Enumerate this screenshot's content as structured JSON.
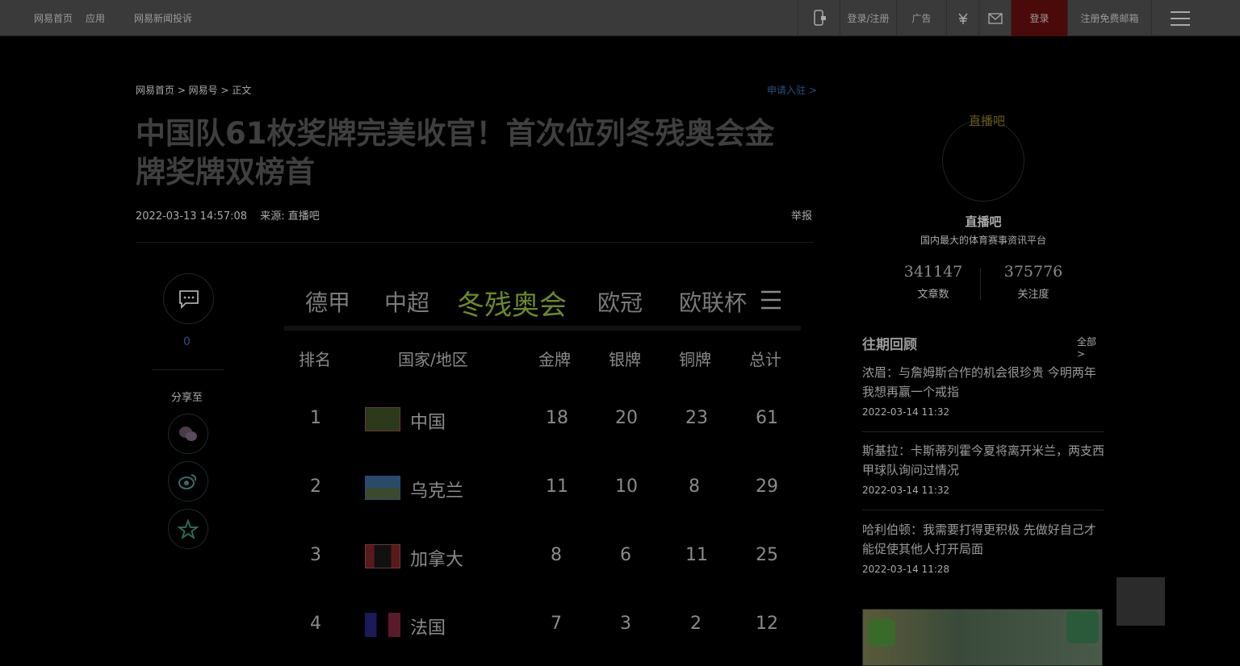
{
  "topbar": {
    "home": "网易首页",
    "app": "应用",
    "ad_link": "网易新闻投诉",
    "mobile": "",
    "account": "登录/注册",
    "games": "广告",
    "login": "登录",
    "user": "注册免费邮箱"
  },
  "breadcrumb": "网易首页 > 网易号 > 正文",
  "apply": "申请入驻 >",
  "article": {
    "title": "中国队61枚奖牌完美收官！首次位列冬残奥会金牌奖牌双榜首",
    "datetime": "2022-03-13 14:57:08",
    "source": "来源: 直播吧",
    "report": "举报"
  },
  "share": {
    "comment_count": "0",
    "label": "分享至"
  },
  "medal_table": {
    "tabs": [
      "德甲",
      "中超",
      "冬残奥会",
      "欧冠",
      "欧联杯"
    ],
    "active_tab": "冬残奥会",
    "headers": [
      "排名",
      "国家/地区",
      "金牌",
      "银牌",
      "铜牌",
      "总计"
    ],
    "rows": [
      {
        "rank": "1",
        "country": "中国",
        "gold": "18",
        "silver": "20",
        "bronze": "23",
        "total": "61"
      },
      {
        "rank": "2",
        "country": "乌克兰",
        "gold": "11",
        "silver": "10",
        "bronze": "8",
        "total": "29"
      },
      {
        "rank": "3",
        "country": "加拿大",
        "gold": "8",
        "silver": "6",
        "bronze": "11",
        "total": "25"
      },
      {
        "rank": "4",
        "country": "法国",
        "gold": "7",
        "silver": "3",
        "bronze": "2",
        "total": "12"
      }
    ]
  },
  "author": {
    "avatar_alt": "直播吧",
    "name": "直播吧",
    "desc": "国内最大的体育赛事资讯平台",
    "articles": "341147",
    "articles_label": "文章数",
    "follows": "375776",
    "follows_label": "关注度"
  },
  "history": {
    "title": "往期回顾",
    "all": "全部 >",
    "items": [
      {
        "title": "浓眉：与詹姆斯合作的机会很珍贵 今明两年我想再赢一个戒指",
        "date": "2022-03-14 11:32"
      },
      {
        "title": "斯基拉：卡斯蒂列霍今夏将离开米兰，两支西甲球队询问过情况",
        "date": "2022-03-14 11:32"
      },
      {
        "title": "哈利伯顿：我需要打得更积极 先做好自己才能促使其他人打开局面",
        "date": "2022-03-14 11:28"
      }
    ]
  }
}
